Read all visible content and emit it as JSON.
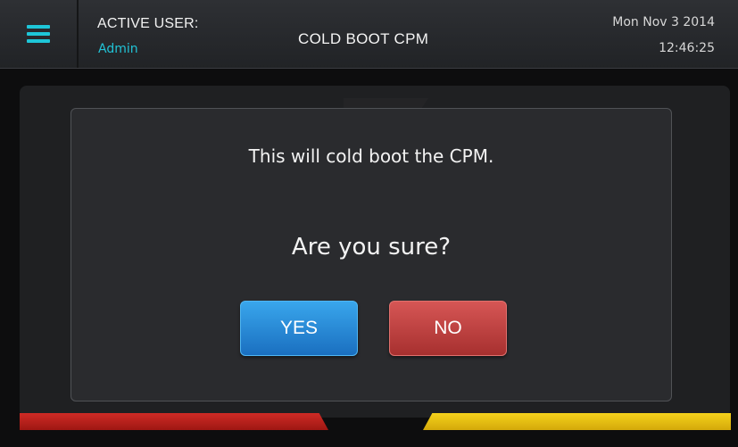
{
  "header": {
    "menu_icon": "hamburger-menu-icon",
    "user_label": "ACTIVE USER:",
    "user_name": "Admin",
    "title": "COLD BOOT CPM",
    "date": "Mon Nov 3 2014",
    "time": "12:46:25"
  },
  "dialog": {
    "message": "This will cold boot the CPM.",
    "question": "Are you sure?",
    "yes_label": "YES",
    "no_label": "NO"
  },
  "colors": {
    "accent_cyan": "#1ec6d8",
    "yes_blue": "#2a8cd8",
    "no_red": "#c44443",
    "strip_red": "#b81f1a",
    "strip_yellow": "#eac215"
  }
}
